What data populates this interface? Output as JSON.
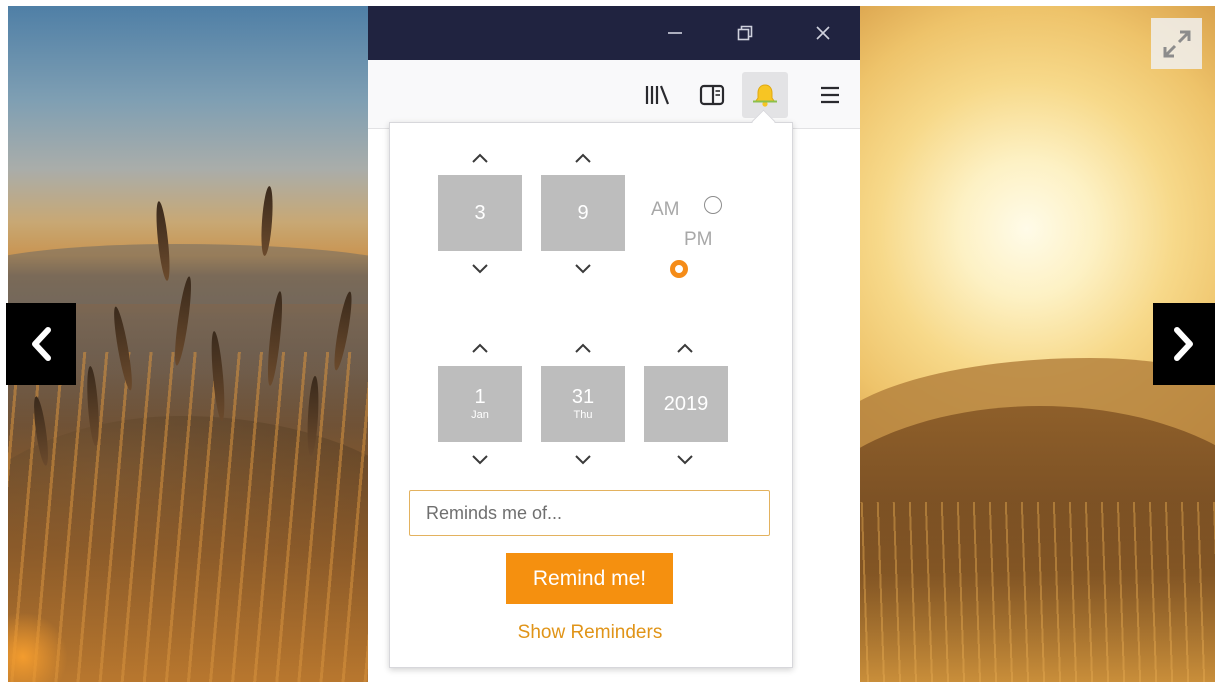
{
  "window": {
    "controls": {
      "minimize_icon": "minimize-icon",
      "restore_icon": "restore-icon",
      "close_icon": "close-icon"
    }
  },
  "toolbar": {
    "items": [
      "library-icon",
      "sidebar-icon",
      "reminder-bell-icon",
      "hamburger-menu-icon"
    ],
    "active_item": "reminder-bell-icon"
  },
  "reminder_popup": {
    "time": {
      "hour": "3",
      "minute": "9",
      "am_label": "AM",
      "pm_label": "PM",
      "selected_period": "PM"
    },
    "date": {
      "month_day": "1",
      "month_name": "Jan",
      "day": "31",
      "weekday": "Thu",
      "year": "2019"
    },
    "input": {
      "placeholder": "Reminds me of...",
      "value": ""
    },
    "submit_label": "Remind me!",
    "show_reminders_label": "Show Reminders"
  },
  "colors": {
    "titlebar": "#202340",
    "accent": "#f5900f",
    "link": "#e09418",
    "spin_box": "#bdbdbd"
  }
}
